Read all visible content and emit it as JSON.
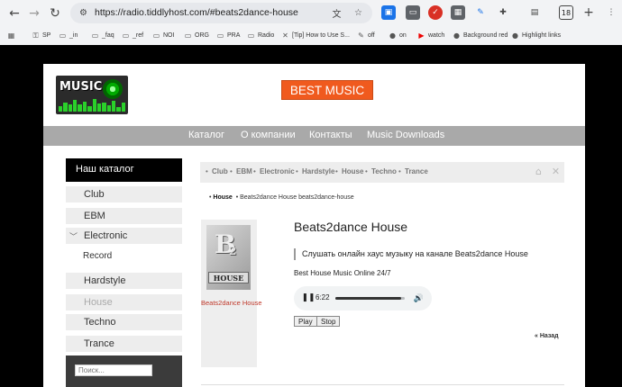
{
  "browser": {
    "url": "https://radio.tiddlyhost.com/#beats2dance-house",
    "tab_count": "18",
    "bookmarks": [
      {
        "label": "SP",
        "icon": "key-icon"
      },
      {
        "label": "_in",
        "icon": "folder-icon"
      },
      {
        "label": "_faq",
        "icon": "folder-icon"
      },
      {
        "label": "_ref",
        "icon": "folder-icon"
      },
      {
        "label": "NOI",
        "icon": "folder-icon"
      },
      {
        "label": "ORG",
        "icon": "folder-icon"
      },
      {
        "label": "PRA",
        "icon": "folder-icon"
      },
      {
        "label": "Radio",
        "icon": "folder-icon"
      },
      {
        "label": "[Tip] How to Use S...",
        "icon": "tip-icon"
      },
      {
        "label": "off",
        "icon": "pen-icon"
      },
      {
        "label": "on",
        "icon": "github-icon"
      },
      {
        "label": "watch",
        "icon": "youtube-icon"
      },
      {
        "label": "Background red",
        "icon": "github-icon"
      },
      {
        "label": "Highlight links",
        "icon": "github-icon"
      }
    ]
  },
  "site": {
    "logo_text": "MUSIC",
    "brand_label": "BEST MUSIC",
    "nav": [
      "Каталог",
      "О компании",
      "Контакты",
      "Music Downloads"
    ]
  },
  "sidebar": {
    "title": "Наш каталог",
    "items": [
      "Club",
      "EBM",
      "Electronic",
      "Record",
      "Hardstyle",
      "House",
      "Techno",
      "Trance"
    ],
    "search_placeholder": "Поиск..."
  },
  "breadcrumb_tags": [
    "Club",
    "EBM",
    "Electronic",
    "Hardstyle",
    "House",
    "Techno",
    "Trance"
  ],
  "path": {
    "tag": "House",
    "items": "Beats2dance House beats2dance-house"
  },
  "station": {
    "thumb_letters": "B",
    "thumb_sub": "2",
    "thumb_label": "HOUSE",
    "card_title": "Beats2dance House",
    "title": "Beats2dance House",
    "quote": "Слушать онлайн хаус музыку на канале Beats2dance House",
    "description": "Best House Music Online 24/7",
    "player_time": "6:22",
    "progress": 0.95,
    "play_label": "Play",
    "stop_label": "Stop",
    "back_label": "Назад"
  }
}
